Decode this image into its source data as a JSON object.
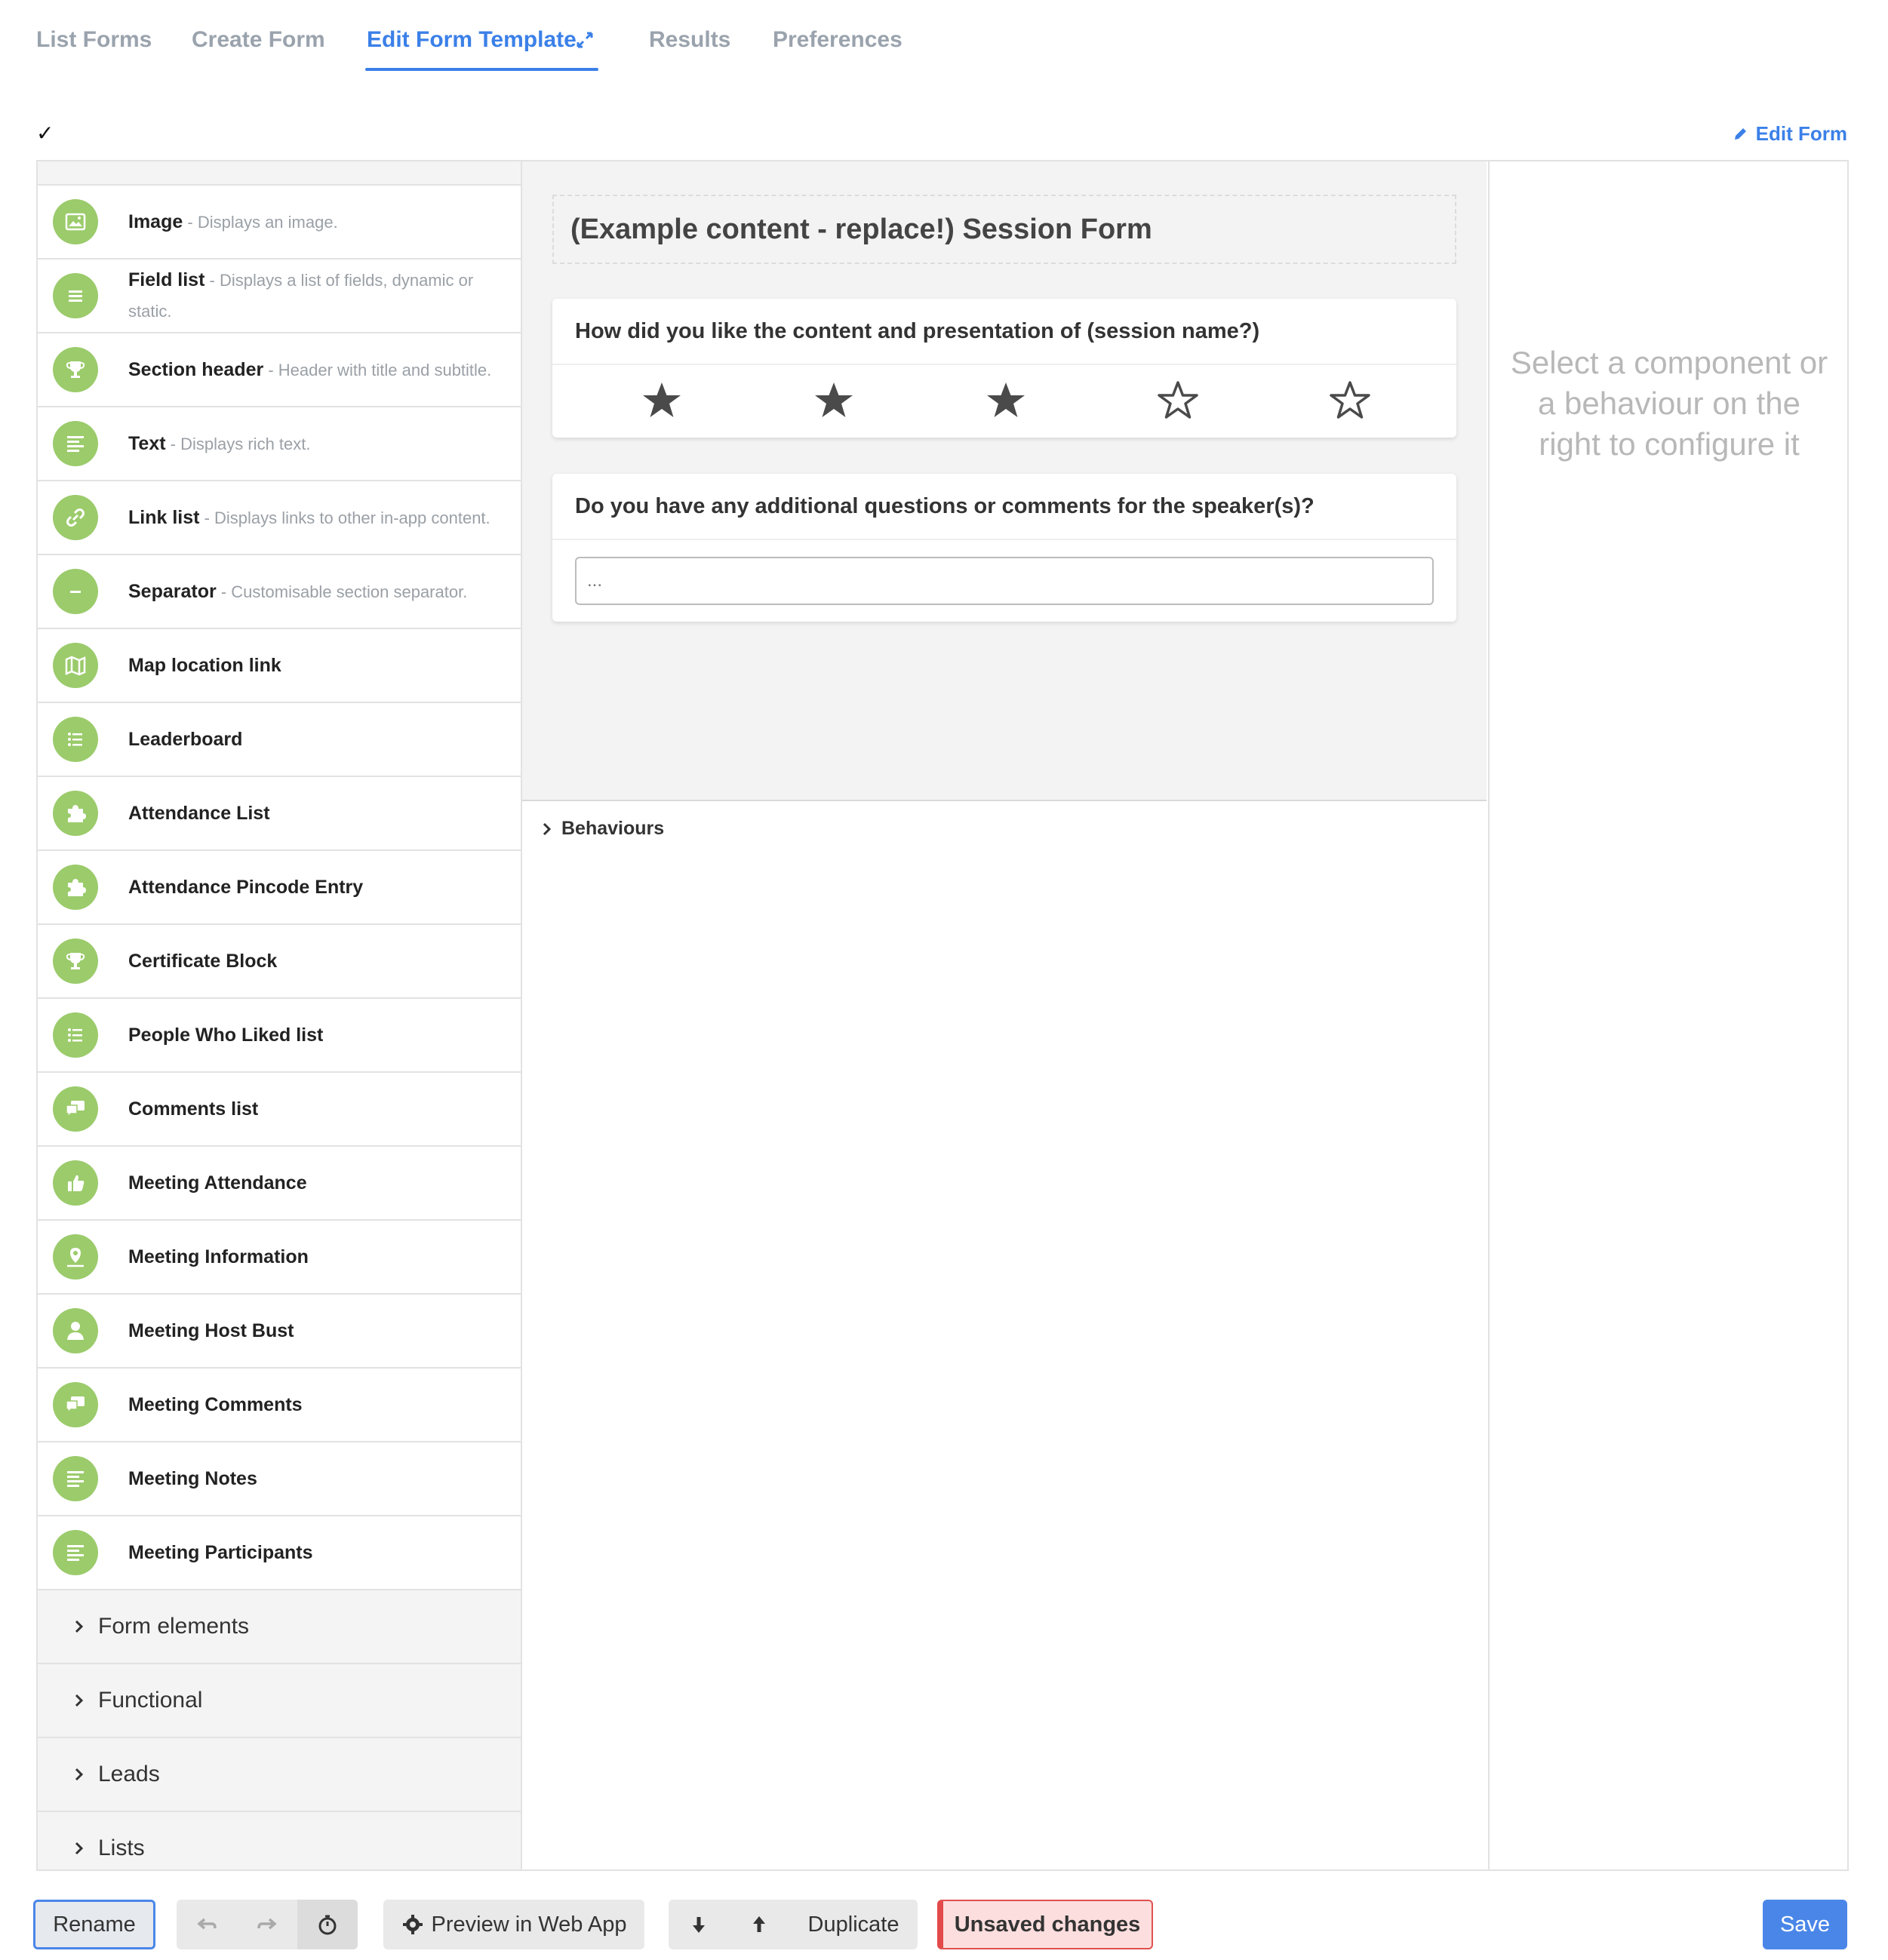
{
  "tabs": [
    {
      "label": "List Forms"
    },
    {
      "label": "Create Form"
    },
    {
      "label": "Edit Form Template"
    },
    {
      "label": "Results"
    },
    {
      "label": "Preferences"
    }
  ],
  "active_tab": "Edit Form Template",
  "status_mark": "✓",
  "edit_form_label": "Edit Form",
  "sidebar": {
    "components": [
      {
        "title": "Image",
        "desc": " - Displays an image.",
        "icon": "image-icon"
      },
      {
        "title": "Field list",
        "desc": " - Displays a list of fields, dynamic or static.",
        "icon": "list-lines-icon"
      },
      {
        "title": "Section header",
        "desc": " - Header with title and subtitle.",
        "icon": "trophy-icon"
      },
      {
        "title": "Text",
        "desc": " - Displays rich text.",
        "icon": "text-lines-icon"
      },
      {
        "title": "Link list",
        "desc": " - Displays links to other in-app content.",
        "icon": "link-icon"
      },
      {
        "title": "Separator",
        "desc": " - Customisable section separator.",
        "icon": "minus-icon"
      },
      {
        "title": "Map location link",
        "desc": "",
        "icon": "map-icon"
      },
      {
        "title": "Leaderboard",
        "desc": "",
        "icon": "bullet-list-icon"
      },
      {
        "title": "Attendance List",
        "desc": "",
        "icon": "puzzle-icon"
      },
      {
        "title": "Attendance Pincode Entry",
        "desc": "",
        "icon": "puzzle-icon"
      },
      {
        "title": "Certificate Block",
        "desc": "",
        "icon": "trophy-icon"
      },
      {
        "title": "People Who Liked list",
        "desc": "",
        "icon": "bullet-list-icon"
      },
      {
        "title": "Comments list",
        "desc": "",
        "icon": "comments-icon"
      },
      {
        "title": "Meeting Attendance",
        "desc": "",
        "icon": "thumbs-up-icon"
      },
      {
        "title": "Meeting Information",
        "desc": "",
        "icon": "map-pin-icon"
      },
      {
        "title": "Meeting Host Bust",
        "desc": "",
        "icon": "person-icon"
      },
      {
        "title": "Meeting Comments",
        "desc": "",
        "icon": "comments-icon"
      },
      {
        "title": "Meeting Notes",
        "desc": "",
        "icon": "text-lines-icon"
      },
      {
        "title": "Meeting Participants",
        "desc": "",
        "icon": "text-lines-icon"
      }
    ],
    "categories": [
      {
        "label": "Form elements"
      },
      {
        "label": "Functional"
      },
      {
        "label": "Leads"
      },
      {
        "label": "Lists"
      }
    ]
  },
  "canvas": {
    "form_title": "(Example content - replace!) Session Form",
    "rating_question": "How did you like the content and presentation of (session name?)",
    "rating": {
      "value": 3,
      "max": 5
    },
    "comment_question": "Do you have any additional questions or comments for the speaker(s)?",
    "comment_placeholder": "..."
  },
  "behaviours_label": "Behaviours",
  "right_panel_hint": "Select a component or a behaviour on the right to configure it",
  "toolbar": {
    "rename": "Rename",
    "preview": "Preview in Web App",
    "duplicate": "Duplicate",
    "unsaved": "Unsaved changes",
    "save": "Save"
  },
  "colors": {
    "accent": "#3b80e8",
    "component_icon_bg": "#9bcb6b",
    "unsaved_bg": "#fddede",
    "unsaved_border": "#e34a4a"
  }
}
